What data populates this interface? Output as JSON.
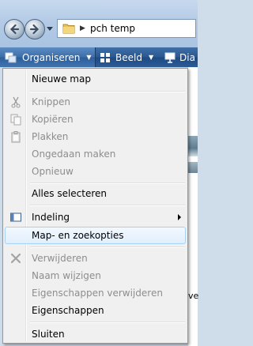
{
  "address": {
    "path": "pch temp"
  },
  "commandbar": {
    "organize_label": "Organiseren",
    "view_label": "Beeld",
    "slideshow_label": "Dia"
  },
  "background": {
    "fragment": "ve"
  },
  "menu": {
    "items": [
      {
        "label": "Nieuwe map",
        "enabled": true
      },
      {
        "label": "Knippen",
        "enabled": false,
        "icon": "scissors-icon"
      },
      {
        "label": "Kopiëren",
        "enabled": false,
        "icon": "copy-icon"
      },
      {
        "label": "Plakken",
        "enabled": false,
        "icon": "paste-icon"
      },
      {
        "label": "Ongedaan maken",
        "enabled": false
      },
      {
        "label": "Opnieuw",
        "enabled": false
      },
      {
        "label": "Alles selecteren",
        "enabled": true
      },
      {
        "label": "Indeling",
        "enabled": true,
        "icon": "layout-icon",
        "submenu": true
      },
      {
        "label": "Map- en zoekopties",
        "enabled": true,
        "highlighted": true
      },
      {
        "label": "Verwijderen",
        "enabled": false,
        "icon": "delete-icon"
      },
      {
        "label": "Naam wijzigen",
        "enabled": false
      },
      {
        "label": "Eigenschappen verwijderen",
        "enabled": false
      },
      {
        "label": "Eigenschappen",
        "enabled": true
      },
      {
        "label": "Sluiten",
        "enabled": true
      }
    ]
  }
}
